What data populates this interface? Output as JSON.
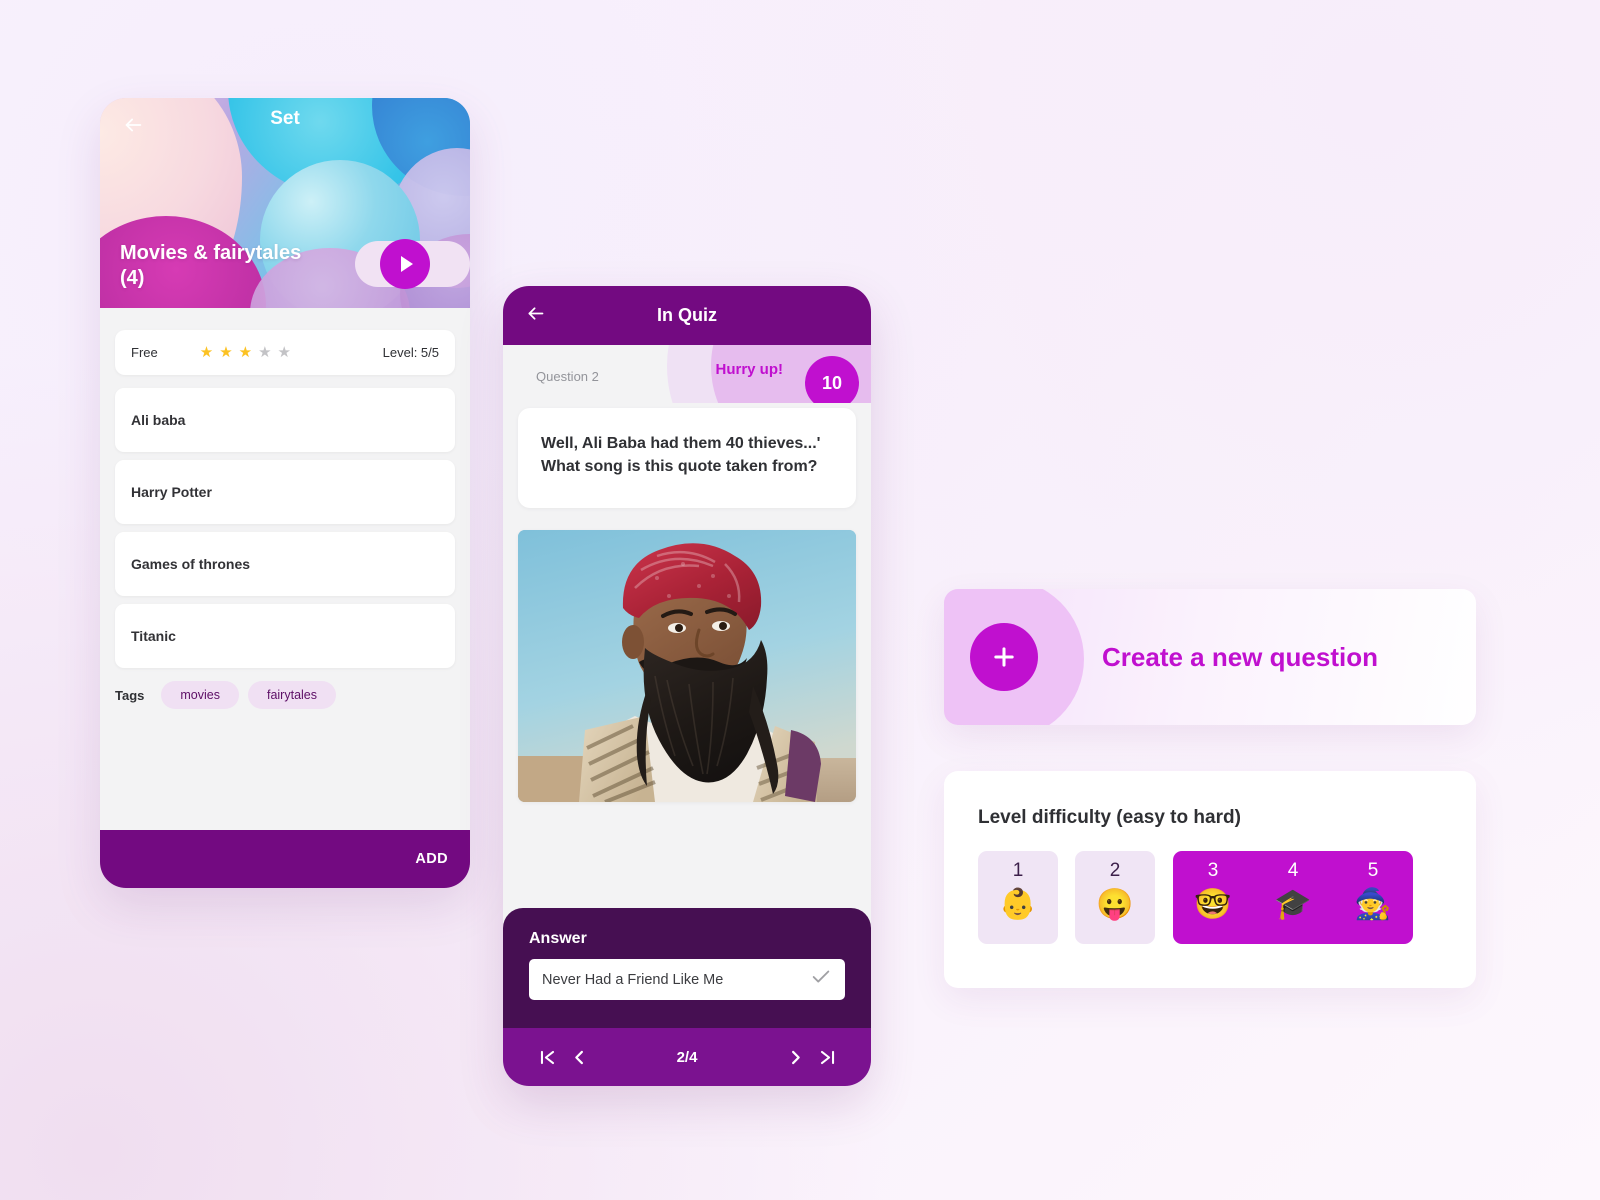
{
  "theme": {
    "brand_magenta": "#c010cf",
    "brand_purple": "#730a81",
    "dark_purple": "#460f52",
    "nav_purple": "#7b1290",
    "star_gold": "#fcc223",
    "star_gray": "#c3c3c6",
    "background": "#f9f2fd"
  },
  "set_screen": {
    "back_icon": "arrow-left-icon",
    "title": "Set",
    "set_name": "Movies & fairytales (4)",
    "play_label": "Play",
    "play_icon": "play-icon",
    "meta": {
      "price": "Free",
      "stars_filled": 3,
      "stars_total": 5,
      "level": "Level: 5/5"
    },
    "items": [
      "Ali baba",
      "Harry Potter",
      "Games of thrones",
      "Titanic"
    ],
    "tags_label": "Tags",
    "tags": [
      "movies",
      "fairytales"
    ],
    "footer_action": "ADD"
  },
  "quiz_screen": {
    "back_icon": "arrow-left-icon",
    "title": "In Quiz",
    "question_number": "Question 2",
    "hurry_label": "Hurry up!",
    "timer_value": "10",
    "question_text": "Well, Ali Baba had them 40 thieves...' What song is this quote taken from?",
    "photo_alt": "bearded-man-red-turban-photo",
    "answer_label": "Answer",
    "answer_value": "Never Had a Friend Like Me",
    "answer_check_icon": "check-icon",
    "nav": {
      "first_icon": "skip-to-first-icon",
      "prev_icon": "chevron-left-icon",
      "page": "2/4",
      "next_icon": "chevron-right-icon",
      "last_icon": "skip-to-last-icon"
    }
  },
  "create_card": {
    "plus_icon": "plus-icon",
    "label": "Create a new question"
  },
  "difficulty_card": {
    "title": "Level difficulty (easy to hard)",
    "levels": [
      {
        "number": "1",
        "emoji": "👶",
        "icon_name": "baby-emoji",
        "selected": false
      },
      {
        "number": "2",
        "emoji": "😛",
        "icon_name": "tongue-face-emoji",
        "selected": false
      },
      {
        "number": "3",
        "emoji": "🤓",
        "icon_name": "nerd-face-emoji",
        "selected": true
      },
      {
        "number": "4",
        "emoji": "🎓",
        "icon_name": "graduation-cap-emoji",
        "selected": true
      },
      {
        "number": "5",
        "emoji": "🧙",
        "icon_name": "wizard-emoji",
        "selected": true
      }
    ]
  }
}
